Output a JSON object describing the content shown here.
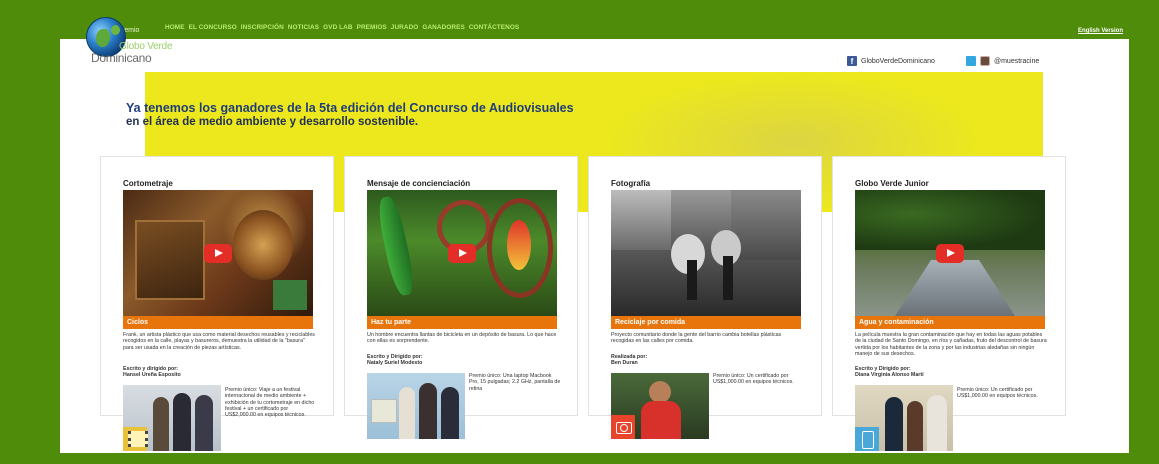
{
  "header": {
    "premio_label": "premio",
    "nav": [
      "HOME",
      "EL CONCURSO",
      "INSCRIPCIÓN",
      "NOTICIAS",
      "GVD LAB",
      "PREMIOS",
      "JURADO",
      "GANADORES",
      "CONTÁCTENOS"
    ],
    "english_link": "English Version"
  },
  "logo": {
    "line1": "Globo Verde",
    "line2": "Dominicano"
  },
  "social": {
    "facebook": "GloboVerdeDominicano",
    "twitter_instagram": "@muestracine"
  },
  "banner": {
    "headline": "Ya tenemos los ganadores de la 5ta edición del Concurso de Audiovisuales",
    "subheadline": "en el área de medio ambiente y desarrollo sostenible."
  },
  "cards": [
    {
      "category": "Cortometraje",
      "caption": "Ciclos",
      "description": "Frank, un artista plástico que usa como material desechos reusables y reciclables recogidos en la calle, playas y basureros, demuestra la utilidad de la \"basura\" para ser usada en la creación de piezas artísticas.",
      "credit_label": "Escrito y dirigido por:",
      "credit_name": "Hansel Ureña Esposito",
      "prize": "Premio único: Viaje a un festival internacional de medio ambiente + exhibición de tu cortometraje en dicho festival + un certificado por US$2,000.00 en equipos técnicos.",
      "badge_icon": "film-icon"
    },
    {
      "category": "Mensaje de concienciación",
      "caption": "Haz tu parte",
      "description": "Un hombre encuentra llantas de bicicleta en un depósito de basura. Lo que hace con ellas es sorprendente.",
      "credit_label": "Escrito y Dirigido por:",
      "credit_name": "Nataly Suriel Modesto",
      "prize": "Premio único: Una laptop Macbook Pro, 15 pulgadas; 2.2 GHz, pantalla de retina",
      "badge_icon": "certificate-icon"
    },
    {
      "category": "Fotografía",
      "caption": "Reciclaje por comida",
      "description": "Proyecto comunitario donde la gente del barrio cambia botellas plásticas recogidas en las calles por comida.",
      "credit_label": "Realizada por:",
      "credit_name": "Ben Duran",
      "prize": "Premio único: Un certificado por US$1,000.00 en equipos técnicos.",
      "badge_icon": "camera-icon"
    },
    {
      "category": "Globo Verde Junior",
      "caption": "Agua y contaminación",
      "description": "La película muestra la gran contaminación que hay en todas las aguas potables de la ciudad de Santo Domingo, en ríos y cañadas, fruto del descontrol de basura vertida por los habitantes de la zona y por las industrias aledañas sin ningún manejo de sus desechos.",
      "credit_label": "Escrito y Dirigido por:",
      "credit_name": "Diana Virginia Alonso Martí",
      "prize": "Premio único: Un certificado por US$1,000.00 en equipos técnicos.",
      "badge_icon": "tablet-icon"
    }
  ],
  "colors": {
    "background_green": "#4f8c0a",
    "nav_text": "#b7ee6c",
    "banner_yellow": "#ece81d",
    "caption_orange": "#e8740c",
    "play_red": "#e52d27"
  }
}
